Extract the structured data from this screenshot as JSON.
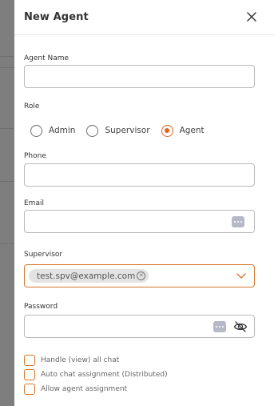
{
  "dialog": {
    "title": "New Agent"
  },
  "form": {
    "agent_name": {
      "label": "Agent Name",
      "value": ""
    },
    "role": {
      "label": "Role",
      "options": [
        "Admin",
        "Supervisor",
        "Agent"
      ],
      "selected": "Agent"
    },
    "phone": {
      "label": "Phone",
      "value": ""
    },
    "email": {
      "label": "Email",
      "value": ""
    },
    "supervisor": {
      "label": "Supervisor",
      "selected_chip": "test.spv@example.com"
    },
    "password": {
      "label": "Password",
      "value": ""
    },
    "checkboxes": [
      {
        "label": "Handle (view) all chat",
        "checked": false
      },
      {
        "label": "Auto chat assignment (Distributed)",
        "checked": false
      },
      {
        "label": "Allow agent assignment",
        "checked": false
      }
    ]
  },
  "colors": {
    "accent": "#e2631f",
    "checkbox_border": "#d4782a",
    "input_border": "#b9b9b9"
  }
}
